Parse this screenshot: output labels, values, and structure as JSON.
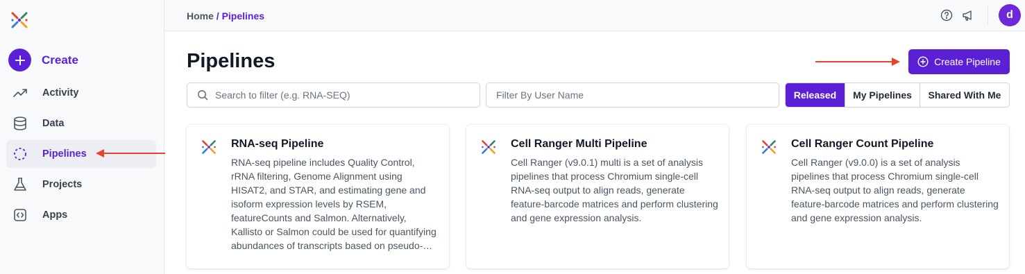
{
  "sidebar": {
    "logo": "app-logo",
    "create_label": "Create",
    "items": [
      {
        "label": "Activity",
        "icon": "trending-up-icon"
      },
      {
        "label": "Data",
        "icon": "database-icon"
      },
      {
        "label": "Pipelines",
        "icon": "pipeline-icon",
        "active": true
      },
      {
        "label": "Projects",
        "icon": "flask-icon"
      },
      {
        "label": "Apps",
        "icon": "code-bracket-icon"
      }
    ]
  },
  "topbar": {
    "breadcrumb_home": "Home",
    "breadcrumb_separator": " / ",
    "breadcrumb_current": "Pipelines",
    "avatar_initial": "d"
  },
  "main": {
    "title": "Pipelines",
    "create_button": "Create Pipeline",
    "search": {
      "placeholder": "Search to filter (e.g. RNA-SEQ)"
    },
    "user_filter": {
      "placeholder": "Filter By User Name"
    },
    "tabs": [
      {
        "label": "Released",
        "active": true
      },
      {
        "label": "My Pipelines"
      },
      {
        "label": "Shared With Me"
      }
    ],
    "cards": [
      {
        "title": "RNA-seq Pipeline",
        "description": "RNA-seq pipeline includes Quality Control, rRNA filtering, Genome Alignment using HISAT2, and STAR, and estimating gene and isoform expression levels by RSEM, featureCounts and Salmon. Alternatively, Kallisto or Salmon could be used for quantifying abundances of transcripts based on pseudo-alignment."
      },
      {
        "title": "Cell Ranger Multi Pipeline",
        "description": "Cell Ranger (v9.0.1) multi is a set of analysis pipelines that process Chromium single-cell RNA-seq output to align reads, generate feature-barcode matrices and perform clustering and gene expression analysis."
      },
      {
        "title": "Cell Ranger Count Pipeline",
        "description": "Cell Ranger (v9.0.0) is a set of analysis pipelines that process Chromium single-cell RNA-seq output to align reads, generate feature-barcode matrices and perform clustering and gene expression analysis."
      }
    ]
  },
  "colors": {
    "accent": "#5b1fd6",
    "annotation_arrow": "#e8432a"
  }
}
